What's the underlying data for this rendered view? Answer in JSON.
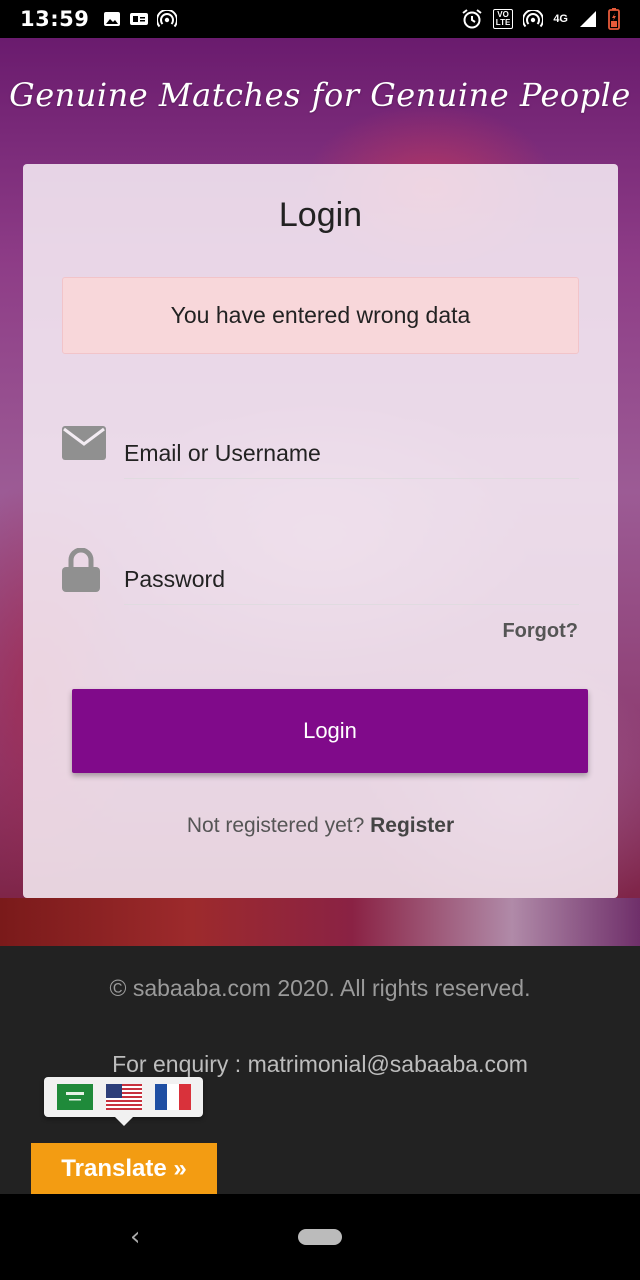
{
  "status_bar": {
    "time": "13:59",
    "network": "4G",
    "lte": "VoLTE",
    "icons": [
      "image-icon",
      "card-icon",
      "hotspot-icon",
      "alarm-icon",
      "lte-icon",
      "signal-icon",
      "battery-icon"
    ]
  },
  "hero": {
    "tagline": "Genuine Matches for Genuine People"
  },
  "login": {
    "title": "Login",
    "error_message": "You have entered wrong data",
    "email_placeholder": "Email or Username",
    "password_placeholder": "Password",
    "forgot_label": "Forgot?",
    "submit_label": "Login",
    "not_registered_text": "Not registered yet?",
    "register_label": "Register"
  },
  "footer": {
    "copyright": "© sabaaba.com 2020. All rights reserved.",
    "enquiry": "For enquiry : matrimonial@sabaaba.com"
  },
  "translate": {
    "label": "Translate »",
    "flags": [
      "Arabic",
      "English",
      "French"
    ]
  },
  "colors": {
    "primary": "#800a8a",
    "alert_bg": "#f8d7da",
    "translate_bg": "#f39c12",
    "footer_bg": "#222222"
  }
}
